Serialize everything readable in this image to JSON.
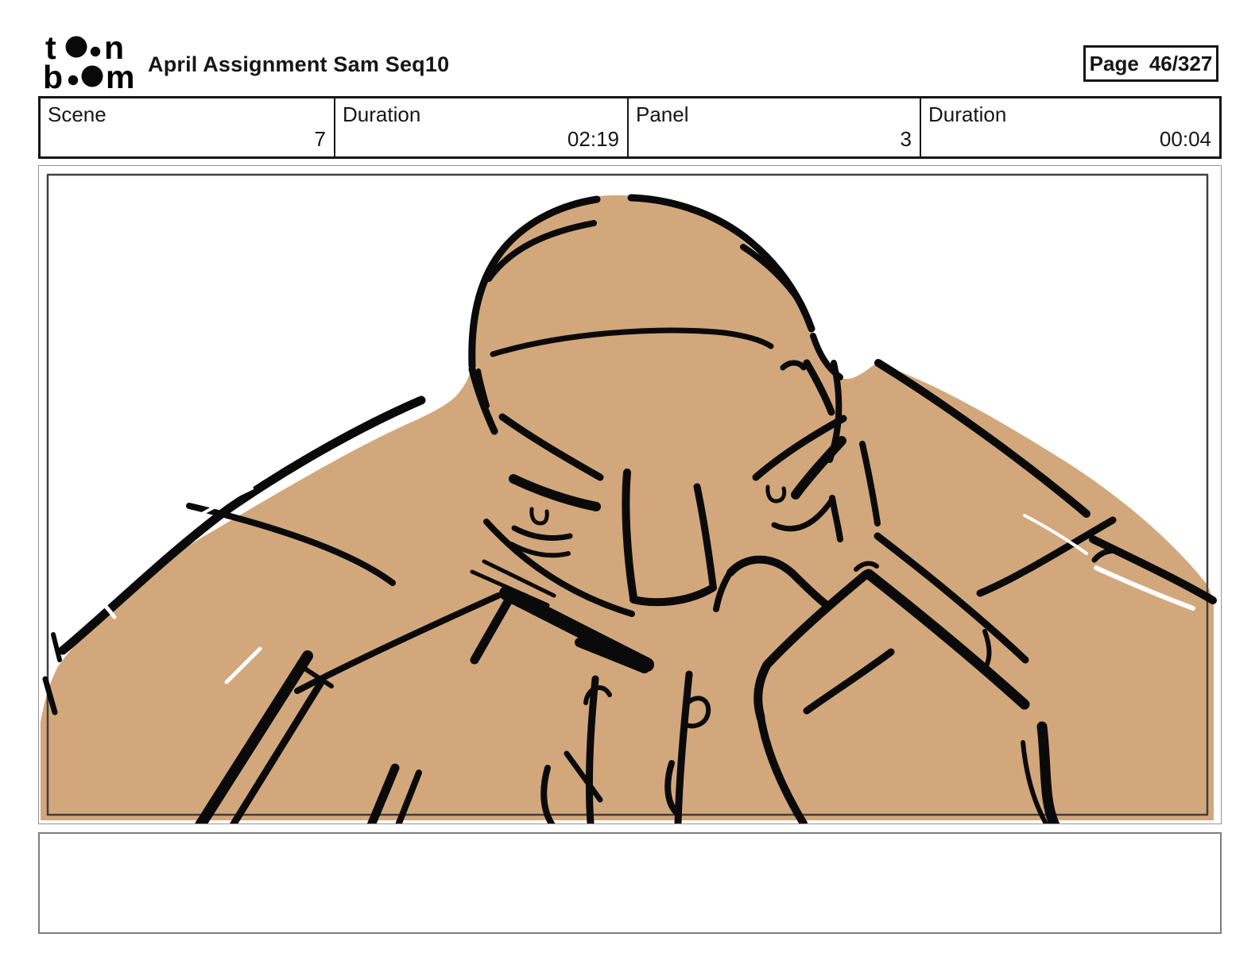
{
  "header": {
    "logo": {
      "icon": "toonboom-logo",
      "word_top_left": "t",
      "word_top_right": "n",
      "word_bottom_left": "b",
      "word_bottom_right": "m"
    },
    "title": "April Assignment Sam Seq10",
    "page_label": "Page",
    "page_value": "46/327"
  },
  "info_row": {
    "cells": [
      {
        "label": "Scene",
        "value": "7"
      },
      {
        "label": "Duration",
        "value": "02:19"
      },
      {
        "label": "Panel",
        "value": "3"
      },
      {
        "label": "Duration",
        "value": "00:04"
      }
    ]
  },
  "panel": {
    "description": "Storyboard drawing: bald muscular man hunched forward, angry expression, fists raised under chin"
  },
  "caption": {
    "text": ""
  },
  "colors": {
    "skin": "#d3a77c",
    "ink": "#0a0a0a",
    "panel_border_outer": "#949494",
    "panel_border_inner": "#3f3f3f",
    "table_border": "#161616",
    "caption_border": "#7d7d7d"
  }
}
